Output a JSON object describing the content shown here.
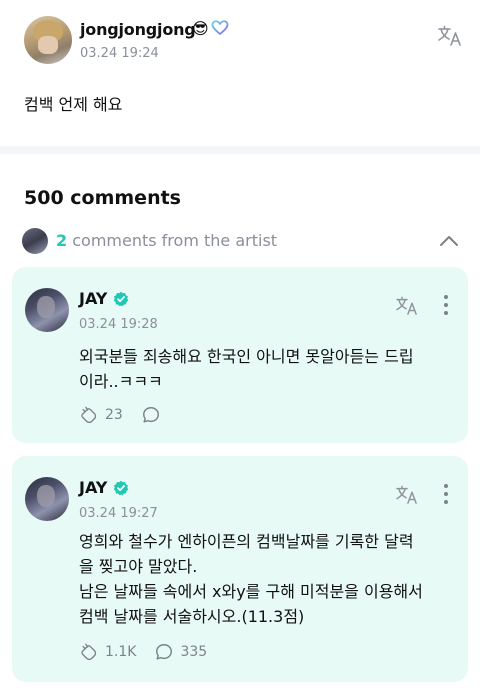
{
  "post": {
    "username": "jongjongjong",
    "emoji": "😎",
    "time": "03.24 19:24",
    "body": "컴백 언제 해요"
  },
  "comments_header": {
    "title": "500 comments",
    "artist_count": "2",
    "artist_text": "comments from the artist"
  },
  "comments": [
    {
      "author": "JAY",
      "time": "03.24 19:28",
      "lines": [
        "외국분들 죄송해요 한국인 아니면 못알아듣는 드립",
        "이라..ㅋㅋㅋ"
      ],
      "likes": "23",
      "replies": ""
    },
    {
      "author": "JAY",
      "time": "03.24 19:27",
      "lines": [
        "영희와 철수가 엔하이픈의 컴백날짜를 기록한 달력",
        "을 찢고야 말았다.",
        "남은 날짜들 속에서 x와y를 구해 미적분을 이용해서",
        "컴백 날짜를 서술하시오.(11.3점)"
      ],
      "likes": "1.1K",
      "replies": "335"
    }
  ],
  "colors": {
    "accent": "#1fc7b4",
    "card_bg": "#e8faf6",
    "muted": "#8a8f98",
    "verified": "#1fc7b4"
  },
  "icons": [
    "translate-icon",
    "verified-icon",
    "more-icon",
    "chevron-up-icon",
    "like-icon",
    "reply-icon",
    "heart-badge-icon"
  ]
}
